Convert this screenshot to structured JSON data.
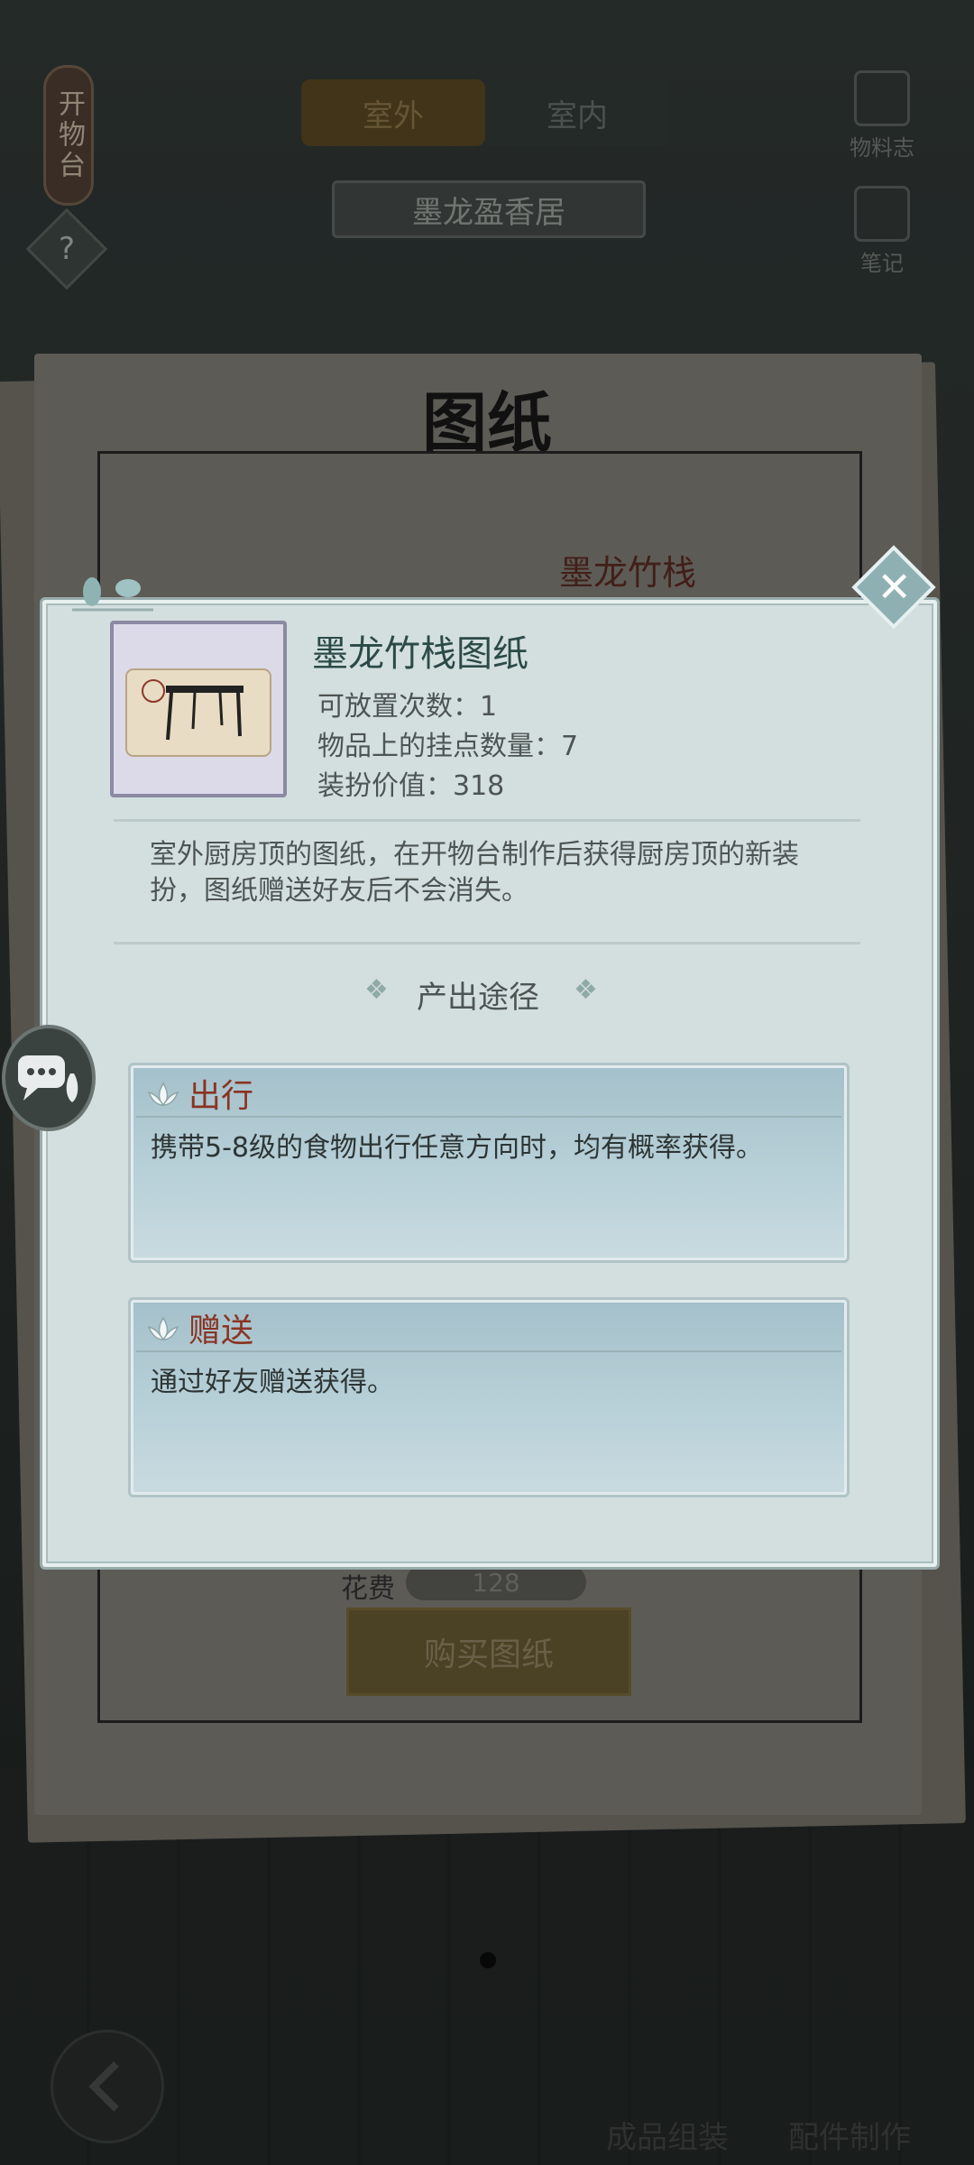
{
  "top": {
    "side_tag": "开物台",
    "help_icon": "?",
    "tabs": [
      {
        "label": "室外",
        "active": true
      },
      {
        "label": "室内",
        "active": false
      }
    ],
    "location": "墨龙盈香居",
    "right_tools": [
      {
        "label": "物料志",
        "icon": "book-icon"
      },
      {
        "label": "笔记",
        "icon": "notebook-icon"
      }
    ]
  },
  "paper": {
    "title": "图纸",
    "item_name": "墨龙竹栈",
    "cost_label": "花费",
    "cost_value": "128",
    "buy_button": "购买图纸"
  },
  "modal": {
    "close_icon": "✕",
    "item_name": "墨龙竹栈图纸",
    "stats": [
      "可放置次数：1",
      "物品上的挂点数量：7",
      "装扮价值：318"
    ],
    "description": "室外厨房顶的图纸，在开物台制作后获得厨房顶的新装扮，图纸赠送好友后不会消失。",
    "source_header": "产出途径",
    "sources": [
      {
        "title": "出行",
        "text": "携带5-8级的食物出行任意方向时，均有概率获得。"
      },
      {
        "title": "赠送",
        "text": "通过好友赠送获得。"
      }
    ]
  },
  "bottom": {
    "back_icon": "back-arrow-icon",
    "buttons": [
      {
        "label": "成品组装"
      },
      {
        "label": "配件制作"
      }
    ]
  },
  "colors": {
    "modal_bg": "#d3dfdf",
    "source_title": "#8a3422",
    "item_title": "#2b4a48"
  }
}
